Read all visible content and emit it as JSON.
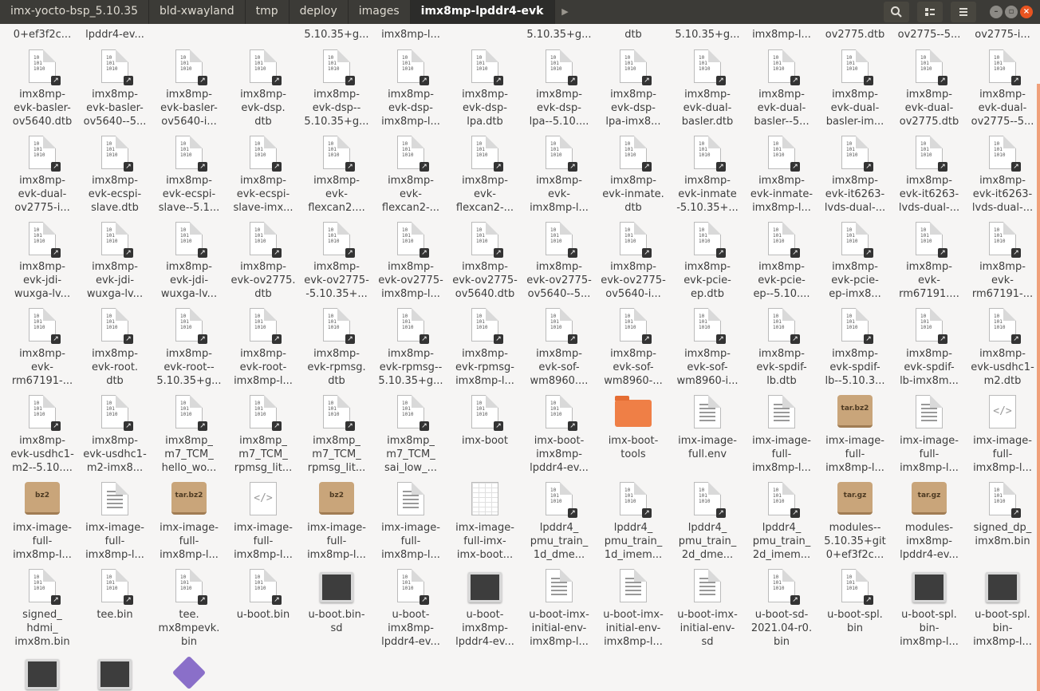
{
  "breadcrumbs": [
    "imx-yocto-bsp_5.10.35",
    "bld-xwayland",
    "tmp",
    "deploy",
    "images",
    "imx8mp-lpddr4-evk"
  ],
  "header_icons": {
    "search": "search-icon",
    "view": "list-view-icon",
    "menu": "hamburger-menu-icon",
    "minimize": "minimize-icon",
    "maximize": "maximize-icon",
    "close": "close-icon"
  },
  "rows": [
    {
      "items": [
        {
          "label": "0+ef3f2c...",
          "icon": "none"
        },
        {
          "label": "lpddr4-ev...",
          "icon": "none"
        },
        {
          "label": "",
          "icon": "none"
        },
        {
          "label": "",
          "icon": "none"
        },
        {
          "label": "5.10.35+g...",
          "icon": "none"
        },
        {
          "label": "imx8mp-l...",
          "icon": "none"
        },
        {
          "label": "",
          "icon": "none"
        },
        {
          "label": "5.10.35+g...",
          "icon": "none"
        },
        {
          "label": "dtb",
          "icon": "none"
        },
        {
          "label": "5.10.35+g...",
          "icon": "none"
        },
        {
          "label": "imx8mp-l...",
          "icon": "none"
        },
        {
          "label": "ov2775.dtb",
          "icon": "none"
        },
        {
          "label": "ov2775--5...",
          "icon": "none"
        },
        {
          "label": "ov2775-i...",
          "icon": "none"
        }
      ]
    },
    {
      "items": [
        {
          "label": "imx8mp-\nevk-basler-\nov5640.dtb",
          "icon": "binary"
        },
        {
          "label": "imx8mp-\nevk-basler-\nov5640--5...",
          "icon": "binary"
        },
        {
          "label": "imx8mp-\nevk-basler-\nov5640-i...",
          "icon": "binary"
        },
        {
          "label": "imx8mp-\nevk-dsp.\ndtb",
          "icon": "binary"
        },
        {
          "label": "imx8mp-\nevk-dsp--\n5.10.35+g...",
          "icon": "binary"
        },
        {
          "label": "imx8mp-\nevk-dsp-\nimx8mp-l...",
          "icon": "binary"
        },
        {
          "label": "imx8mp-\nevk-dsp-\nlpa.dtb",
          "icon": "binary"
        },
        {
          "label": "imx8mp-\nevk-dsp-\nlpa--5.10....",
          "icon": "binary"
        },
        {
          "label": "imx8mp-\nevk-dsp-\nlpa-imx8...",
          "icon": "binary"
        },
        {
          "label": "imx8mp-\nevk-dual-\nbasler.dtb",
          "icon": "binary"
        },
        {
          "label": "imx8mp-\nevk-dual-\nbasler--5...",
          "icon": "binary"
        },
        {
          "label": "imx8mp-\nevk-dual-\nbasler-im...",
          "icon": "binary"
        },
        {
          "label": "imx8mp-\nevk-dual-\nov2775.dtb",
          "icon": "binary"
        },
        {
          "label": "imx8mp-\nevk-dual-\nov2775--5...",
          "icon": "binary"
        }
      ]
    },
    {
      "items": [
        {
          "label": "imx8mp-\nevk-dual-\nov2775-i...",
          "icon": "binary"
        },
        {
          "label": "imx8mp-\nevk-ecspi-\nslave.dtb",
          "icon": "binary"
        },
        {
          "label": "imx8mp-\nevk-ecspi-\nslave--5.1...",
          "icon": "binary"
        },
        {
          "label": "imx8mp-\nevk-ecspi-\nslave-imx...",
          "icon": "binary"
        },
        {
          "label": "imx8mp-\nevk-\nflexcan2....",
          "icon": "binary"
        },
        {
          "label": "imx8mp-\nevk-\nflexcan2-...",
          "icon": "binary"
        },
        {
          "label": "imx8mp-\nevk-\nflexcan2-...",
          "icon": "binary"
        },
        {
          "label": "imx8mp-\nevk-\nimx8mp-l...",
          "icon": "binary"
        },
        {
          "label": "imx8mp-\nevk-inmate.\ndtb",
          "icon": "binary"
        },
        {
          "label": "imx8mp-\nevk-inmate\n-5.10.35+...",
          "icon": "binary"
        },
        {
          "label": "imx8mp-\nevk-inmate-\nimx8mp-l...",
          "icon": "binary"
        },
        {
          "label": "imx8mp-\nevk-it6263-\nlvds-dual-...",
          "icon": "binary"
        },
        {
          "label": "imx8mp-\nevk-it6263-\nlvds-dual-...",
          "icon": "binary"
        },
        {
          "label": "imx8mp-\nevk-it6263-\nlvds-dual-...",
          "icon": "binary"
        }
      ]
    },
    {
      "items": [
        {
          "label": "imx8mp-\nevk-jdi-\nwuxga-lv...",
          "icon": "binary"
        },
        {
          "label": "imx8mp-\nevk-jdi-\nwuxga-lv...",
          "icon": "binary"
        },
        {
          "label": "imx8mp-\nevk-jdi-\nwuxga-lv...",
          "icon": "binary"
        },
        {
          "label": "imx8mp-\nevk-ov2775.\ndtb",
          "icon": "binary"
        },
        {
          "label": "imx8mp-\nevk-ov2775-\n-5.10.35+...",
          "icon": "binary"
        },
        {
          "label": "imx8mp-\nevk-ov2775-\nimx8mp-l...",
          "icon": "binary"
        },
        {
          "label": "imx8mp-\nevk-ov2775-\nov5640.dtb",
          "icon": "binary"
        },
        {
          "label": "imx8mp-\nevk-ov2775-\nov5640--5...",
          "icon": "binary"
        },
        {
          "label": "imx8mp-\nevk-ov2775-\nov5640-i...",
          "icon": "binary"
        },
        {
          "label": "imx8mp-\nevk-pcie-\nep.dtb",
          "icon": "binary"
        },
        {
          "label": "imx8mp-\nevk-pcie-\nep--5.10....",
          "icon": "binary"
        },
        {
          "label": "imx8mp-\nevk-pcie-\nep-imx8...",
          "icon": "binary"
        },
        {
          "label": "imx8mp-\nevk-\nrm67191....",
          "icon": "binary"
        },
        {
          "label": "imx8mp-\nevk-\nrm67191-...",
          "icon": "binary"
        }
      ]
    },
    {
      "items": [
        {
          "label": "imx8mp-\nevk-\nrm67191-...",
          "icon": "binary"
        },
        {
          "label": "imx8mp-\nevk-root.\ndtb",
          "icon": "binary"
        },
        {
          "label": "imx8mp-\nevk-root--\n5.10.35+g...",
          "icon": "binary"
        },
        {
          "label": "imx8mp-\nevk-root-\nimx8mp-l...",
          "icon": "binary"
        },
        {
          "label": "imx8mp-\nevk-rpmsg.\ndtb",
          "icon": "binary"
        },
        {
          "label": "imx8mp-\nevk-rpmsg--\n5.10.35+g...",
          "icon": "binary"
        },
        {
          "label": "imx8mp-\nevk-rpmsg-\nimx8mp-l...",
          "icon": "binary"
        },
        {
          "label": "imx8mp-\nevk-sof-\nwm8960....",
          "icon": "binary"
        },
        {
          "label": "imx8mp-\nevk-sof-\nwm8960-...",
          "icon": "binary"
        },
        {
          "label": "imx8mp-\nevk-sof-\nwm8960-i...",
          "icon": "binary"
        },
        {
          "label": "imx8mp-\nevk-spdif-\nlb.dtb",
          "icon": "binary"
        },
        {
          "label": "imx8mp-\nevk-spdif-\nlb--5.10.3...",
          "icon": "binary"
        },
        {
          "label": "imx8mp-\nevk-spdif-\nlb-imx8m...",
          "icon": "binary"
        },
        {
          "label": "imx8mp-\nevk-usdhc1-\nm2.dtb",
          "icon": "binary"
        }
      ]
    },
    {
      "items": [
        {
          "label": "imx8mp-\nevk-usdhc1-\nm2--5.10....",
          "icon": "binary"
        },
        {
          "label": "imx8mp-\nevk-usdhc1-\nm2-imx8...",
          "icon": "binary"
        },
        {
          "label": "imx8mp_\nm7_TCM_\nhello_wo...",
          "icon": "binary"
        },
        {
          "label": "imx8mp_\nm7_TCM_\nrpmsg_lit...",
          "icon": "binary"
        },
        {
          "label": "imx8mp_\nm7_TCM_\nrpmsg_lit...",
          "icon": "binary"
        },
        {
          "label": "imx8mp_\nm7_TCM_\nsai_low_...",
          "icon": "binary"
        },
        {
          "label": "imx-boot",
          "icon": "binary"
        },
        {
          "label": "imx-boot-\nimx8mp-\nlpddr4-ev...",
          "icon": "binary"
        },
        {
          "label": "imx-boot-\ntools",
          "icon": "folder"
        },
        {
          "label": "imx-image-\nfull.env",
          "icon": "text"
        },
        {
          "label": "imx-image-\nfull-\nimx8mp-l...",
          "icon": "text"
        },
        {
          "label": "imx-image-\nfull-\nimx8mp-l...",
          "icon": "archive",
          "badge": "tar.bz2"
        },
        {
          "label": "imx-image-\nfull-\nimx8mp-l...",
          "icon": "text"
        },
        {
          "label": "imx-image-\nfull-\nimx8mp-l...",
          "icon": "code"
        }
      ]
    },
    {
      "items": [
        {
          "label": "imx-image-\nfull-\nimx8mp-l...",
          "icon": "archive",
          "badge": "bz2"
        },
        {
          "label": "imx-image-\nfull-\nimx8mp-l...",
          "icon": "text"
        },
        {
          "label": "imx-image-\nfull-\nimx8mp-l...",
          "icon": "archive",
          "badge": "tar.bz2"
        },
        {
          "label": "imx-image-\nfull-\nimx8mp-l...",
          "icon": "code"
        },
        {
          "label": "imx-image-\nfull-\nimx8mp-l...",
          "icon": "archive",
          "badge": "bz2"
        },
        {
          "label": "imx-image-\nfull-\nimx8mp-l...",
          "icon": "text"
        },
        {
          "label": "imx-image-\nfull-imx-\nimx-boot...",
          "icon": "sheet"
        },
        {
          "label": "lpddr4_\npmu_train_\n1d_dme...",
          "icon": "binary"
        },
        {
          "label": "lpddr4_\npmu_train_\n1d_imem...",
          "icon": "binary"
        },
        {
          "label": "lpddr4_\npmu_train_\n2d_dme...",
          "icon": "binary"
        },
        {
          "label": "lpddr4_\npmu_train_\n2d_imem...",
          "icon": "binary"
        },
        {
          "label": "modules--\n5.10.35+git\n0+ef3f2c...",
          "icon": "archive",
          "badge": "tar.gz"
        },
        {
          "label": "modules-\nimx8mp-\nlpddr4-ev...",
          "icon": "archive",
          "badge": "tar.gz"
        },
        {
          "label": "signed_dp_\nimx8m.bin",
          "icon": "binary"
        }
      ]
    },
    {
      "items": [
        {
          "label": "signed_\nhdmi_\nimx8m.bin",
          "icon": "binary"
        },
        {
          "label": "tee.bin",
          "icon": "binary"
        },
        {
          "label": "tee.\nmx8mpevk.\nbin",
          "icon": "binary"
        },
        {
          "label": "u-boot.bin",
          "icon": "binary"
        },
        {
          "label": "u-boot.bin-\nsd",
          "icon": "exec"
        },
        {
          "label": "u-boot-\nimx8mp-\nlpddr4-ev...",
          "icon": "binary"
        },
        {
          "label": "u-boot-\nimx8mp-\nlpddr4-ev...",
          "icon": "exec"
        },
        {
          "label": "u-boot-imx-\ninitial-env-\nimx8mp-l...",
          "icon": "text"
        },
        {
          "label": "u-boot-imx-\ninitial-env-\nimx8mp-l...",
          "icon": "text"
        },
        {
          "label": "u-boot-imx-\ninitial-env-\nsd",
          "icon": "text"
        },
        {
          "label": "u-boot-sd-\n2021.04-r0.\nbin",
          "icon": "binary"
        },
        {
          "label": "u-boot-spl.\nbin",
          "icon": "binary"
        },
        {
          "label": "u-boot-spl.\nbin-\nimx8mp-l...",
          "icon": "exec"
        },
        {
          "label": "u-boot-spl.\nbin-\nimx8mp-l...",
          "icon": "exec"
        }
      ]
    },
    {
      "items": [
        {
          "label": "",
          "icon": "exec"
        },
        {
          "label": "",
          "icon": "exec"
        },
        {
          "label": "",
          "icon": "diamond"
        }
      ]
    }
  ]
}
